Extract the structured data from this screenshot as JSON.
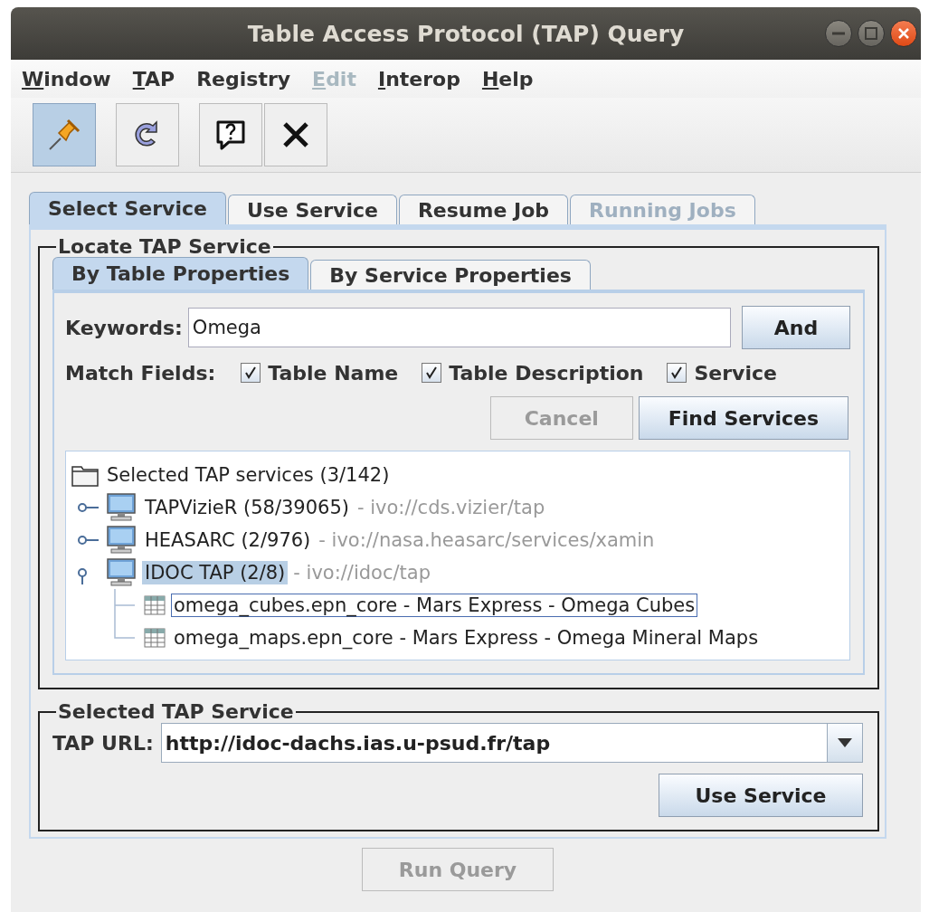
{
  "window": {
    "title": "Table Access Protocol (TAP) Query"
  },
  "menu": [
    {
      "label": "Window",
      "mnemonic": true,
      "disabled": false
    },
    {
      "label": "TAP",
      "mnemonic": true,
      "disabled": false
    },
    {
      "label": "Registry",
      "mnemonic": false,
      "disabled": false
    },
    {
      "label": "Edit",
      "mnemonic": true,
      "disabled": true
    },
    {
      "label": "Interop",
      "mnemonic": true,
      "disabled": false
    },
    {
      "label": "Help",
      "mnemonic": true,
      "disabled": false
    }
  ],
  "toolbar": [
    {
      "kind": "pin",
      "selected": true
    },
    {
      "kind": "refresh",
      "selected": false
    },
    {
      "kind": "help",
      "selected": false
    },
    {
      "kind": "close",
      "selected": false
    }
  ],
  "tabs": [
    {
      "label": "Select Service",
      "selected": true,
      "disabled": false
    },
    {
      "label": "Use Service",
      "selected": false,
      "disabled": false
    },
    {
      "label": "Resume Job",
      "selected": false,
      "disabled": false
    },
    {
      "label": "Running Jobs",
      "selected": false,
      "disabled": true
    }
  ],
  "locate": {
    "title": "Locate TAP Service",
    "tabs": [
      {
        "label": "By Table Properties",
        "selected": true
      },
      {
        "label": "By Service Properties",
        "selected": false
      }
    ],
    "keywords_label": "Keywords:",
    "keywords": "Omega",
    "and_button": "And",
    "match_label": "Match Fields:",
    "match_fields": [
      {
        "label": "Table Name",
        "checked": true
      },
      {
        "label": "Table Description",
        "checked": true
      },
      {
        "label": "Service",
        "checked": true
      }
    ],
    "cancel": {
      "label": "Cancel",
      "disabled": true
    },
    "find": {
      "label": "Find Services",
      "disabled": false
    },
    "tree": {
      "label": "Selected TAP services (3/142)",
      "kind": "folder",
      "children": [
        {
          "label": "TAPVizieR (58/39065)",
          "detail": "- ivo://cds.vizier/tap",
          "kind": "service",
          "expanded": false,
          "selected": false
        },
        {
          "label": "HEASARC (2/976)",
          "detail": "- ivo://nasa.heasarc/services/xamin",
          "kind": "service",
          "expanded": false,
          "selected": false
        },
        {
          "label": "IDOC TAP (2/8)",
          "detail": "- ivo://idoc/tap",
          "kind": "service",
          "expanded": true,
          "selected": true,
          "children": [
            {
              "label": "omega_cubes.epn_core - Mars Express - Omega Cubes",
              "kind": "table",
              "focused": true
            },
            {
              "label": "omega_maps.epn_core - Mars Express - Omega Mineral Maps",
              "kind": "table",
              "focused": false
            }
          ]
        }
      ]
    }
  },
  "selected_service": {
    "title": "Selected TAP Service",
    "url_label": "TAP URL:",
    "url": "http://idoc-dachs.ias.u-psud.fr/tap",
    "use_button": "Use Service"
  },
  "run_query": {
    "label": "Run Query",
    "disabled": true
  }
}
